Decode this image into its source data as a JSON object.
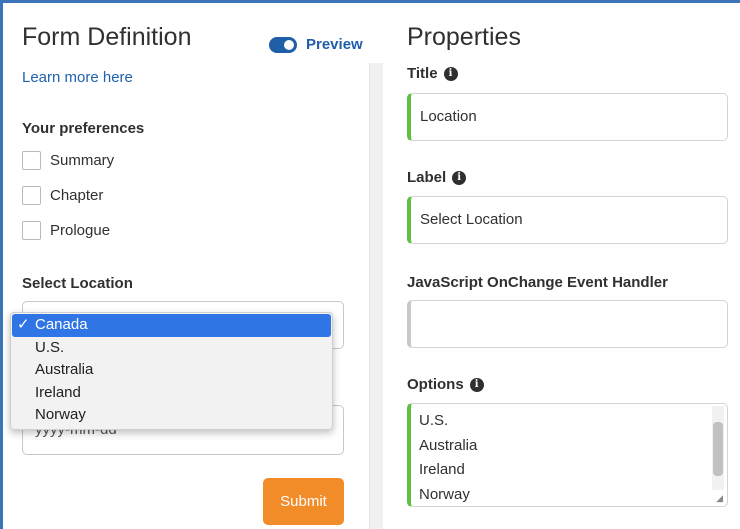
{
  "form": {
    "title": "Form Definition",
    "preview_label": "Preview",
    "learn_link": "Learn more here",
    "preferences": {
      "title": "Your preferences",
      "options": [
        "Summary",
        "Chapter",
        "Prologue"
      ]
    },
    "location": {
      "title": "Select Location",
      "selected": "Canada",
      "options": [
        "Canada",
        "U.S.",
        "Australia",
        "Ireland",
        "Norway"
      ],
      "check_mark": "✓"
    },
    "date": {
      "placeholder": "yyyy-mm-dd"
    },
    "submit_label": "Submit"
  },
  "properties": {
    "title": "Properties",
    "title_field": {
      "label": "Title",
      "value": "Location"
    },
    "label_field": {
      "label": "Label",
      "value": "Select Location"
    },
    "onchange_field": {
      "label": "JavaScript OnChange Event Handler",
      "value": ""
    },
    "options_field": {
      "label": "Options",
      "lines": [
        "U.S.",
        "Australia",
        "Ireland",
        "Norway"
      ]
    }
  },
  "icons": {
    "info": "info-circle-icon",
    "toggle": "toggle-switch-icon",
    "check": "checkmark-icon",
    "resize": "resize-grip-icon"
  },
  "colors": {
    "accent_blue": "#1f5fa8",
    "link_blue": "#1f62b0",
    "submit_orange": "#f28c28",
    "valid_green": "#5fbf40",
    "selected_option": "#2f75e6",
    "frame_blue": "#3b74b8"
  }
}
